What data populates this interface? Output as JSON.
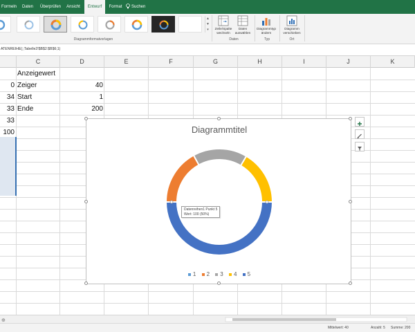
{
  "ribbon": {
    "tabs": [
      "Formeln",
      "Daten",
      "Überprüfen",
      "Ansicht",
      "Entwurf",
      "Format"
    ],
    "active_tab": "Entwurf",
    "tell_me": "Suchen",
    "groups": {
      "styles_label": "Diagrammformatvorlagen",
      "data_label": "Daten",
      "type_label": "Typ",
      "location_label": "Ort"
    },
    "buttons": {
      "switch_row_col": "Zeile/Spalte wechseln",
      "select_data": "Daten auswählen",
      "change_type": "Diagrammtyp ändern",
      "move_chart": "Diagramm verschieben"
    }
  },
  "formula_bar": {
    "formula": "ATENREIHE(;;Tabelle2!$B$2:$B$6;1)"
  },
  "grid": {
    "columns": [
      "C",
      "D",
      "E",
      "F",
      "G",
      "H",
      "I",
      "J",
      "K"
    ],
    "col_b_values": [
      "0",
      "34",
      "33",
      "33",
      "100"
    ],
    "header_cell": "Anzeigewert",
    "rows": [
      {
        "label": "Zeiger",
        "value": "40"
      },
      {
        "label": "Start",
        "value": "1"
      },
      {
        "label": "Ende",
        "value": "200"
      }
    ]
  },
  "chart": {
    "title": "Diagrammtitel",
    "tooltip_line1": "Datenreihen1 Punkt 5",
    "tooltip_line2": "Wert: 100 (50%)",
    "colors": [
      "#5b9bd5",
      "#ed7d31",
      "#a5a5a5",
      "#ffc000",
      "#4472c4"
    ]
  },
  "chart_data": {
    "type": "pie",
    "variant": "doughnut",
    "title": "Diagrammtitel",
    "categories": [
      "1",
      "2",
      "3",
      "4",
      "5"
    ],
    "values": [
      0,
      34,
      33,
      33,
      100
    ],
    "legend": "bottom"
  },
  "status_bar": {
    "average": "Mittelwert: 40",
    "count": "Anzahl: 5",
    "sum": "Summe: 200"
  }
}
